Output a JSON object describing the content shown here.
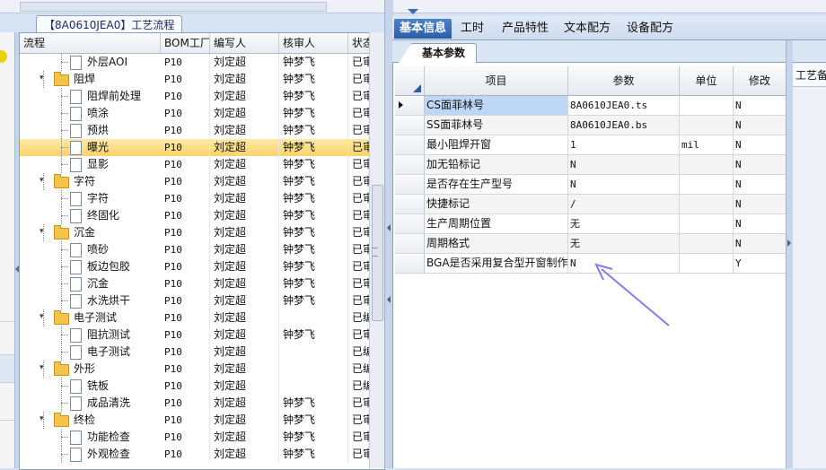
{
  "tree_window": {
    "title": "【8A0610JEA0】工艺流程",
    "columns": [
      "流程",
      "BOM工厂",
      "编写人",
      "核审人",
      "状态"
    ],
    "rows": [
      {
        "name": "外层AOI",
        "level": 2,
        "type": "doc",
        "factory": "P10",
        "writer": "刘定超",
        "reviewer": "钟梦飞",
        "status": "已审"
      },
      {
        "name": "阻焊",
        "level": 1,
        "type": "folder",
        "factory": "P10",
        "writer": "刘定超",
        "reviewer": "钟梦飞",
        "status": "已审"
      },
      {
        "name": "阻焊前处理",
        "level": 2,
        "type": "doc",
        "factory": "P10",
        "writer": "刘定超",
        "reviewer": "钟梦飞",
        "status": "已审"
      },
      {
        "name": "喷涂",
        "level": 2,
        "type": "doc",
        "factory": "P10",
        "writer": "刘定超",
        "reviewer": "钟梦飞",
        "status": "已审"
      },
      {
        "name": "预烘",
        "level": 2,
        "type": "doc",
        "factory": "P10",
        "writer": "刘定超",
        "reviewer": "钟梦飞",
        "status": "已审"
      },
      {
        "name": "曝光",
        "level": 2,
        "type": "doc",
        "factory": "P10",
        "writer": "刘定超",
        "reviewer": "钟梦飞",
        "status": "已审",
        "selected": true
      },
      {
        "name": "显影",
        "level": 2,
        "type": "doc",
        "factory": "P10",
        "writer": "刘定超",
        "reviewer": "钟梦飞",
        "status": "已审"
      },
      {
        "name": "字符",
        "level": 1,
        "type": "folder",
        "factory": "P10",
        "writer": "刘定超",
        "reviewer": "钟梦飞",
        "status": "已审"
      },
      {
        "name": "字符",
        "level": 2,
        "type": "doc",
        "factory": "P10",
        "writer": "刘定超",
        "reviewer": "钟梦飞",
        "status": "已审"
      },
      {
        "name": "终固化",
        "level": 2,
        "type": "doc",
        "factory": "P10",
        "writer": "刘定超",
        "reviewer": "钟梦飞",
        "status": "已审"
      },
      {
        "name": "沉金",
        "level": 1,
        "type": "folder",
        "factory": "P10",
        "writer": "刘定超",
        "reviewer": "钟梦飞",
        "status": "已审"
      },
      {
        "name": "喷砂",
        "level": 2,
        "type": "doc",
        "factory": "P10",
        "writer": "刘定超",
        "reviewer": "钟梦飞",
        "status": "已审"
      },
      {
        "name": "板边包胶",
        "level": 2,
        "type": "doc",
        "factory": "P10",
        "writer": "刘定超",
        "reviewer": "钟梦飞",
        "status": "已审"
      },
      {
        "name": "沉金",
        "level": 2,
        "type": "doc",
        "factory": "P10",
        "writer": "刘定超",
        "reviewer": "钟梦飞",
        "status": "已审"
      },
      {
        "name": "水洗烘干",
        "level": 2,
        "type": "doc",
        "factory": "P10",
        "writer": "刘定超",
        "reviewer": "钟梦飞",
        "status": "已审"
      },
      {
        "name": "电子测试",
        "level": 1,
        "type": "folder",
        "factory": "P10",
        "writer": "刘定超",
        "reviewer": "",
        "status": "已编"
      },
      {
        "name": "阻抗测试",
        "level": 2,
        "type": "doc",
        "factory": "P10",
        "writer": "刘定超",
        "reviewer": "钟梦飞",
        "status": "已审"
      },
      {
        "name": "电子测试",
        "level": 2,
        "type": "doc",
        "factory": "P10",
        "writer": "刘定超",
        "reviewer": "",
        "status": "已编"
      },
      {
        "name": "外形",
        "level": 1,
        "type": "folder",
        "factory": "P10",
        "writer": "刘定超",
        "reviewer": "",
        "status": "已编"
      },
      {
        "name": "铣板",
        "level": 2,
        "type": "doc",
        "factory": "P10",
        "writer": "刘定超",
        "reviewer": "",
        "status": "已编"
      },
      {
        "name": "成品清洗",
        "level": 2,
        "type": "doc",
        "factory": "P10",
        "writer": "刘定超",
        "reviewer": "钟梦飞",
        "status": "已审"
      },
      {
        "name": "终检",
        "level": 1,
        "type": "folder",
        "factory": "P10",
        "writer": "刘定超",
        "reviewer": "钟梦飞",
        "status": "已审"
      },
      {
        "name": "功能检查",
        "level": 2,
        "type": "doc",
        "factory": "P10",
        "writer": "刘定超",
        "reviewer": "钟梦飞",
        "status": "已审"
      },
      {
        "name": "外观检查",
        "level": 2,
        "type": "doc",
        "factory": "P10",
        "writer": "刘定超",
        "reviewer": "钟梦飞",
        "status": "已审"
      }
    ]
  },
  "main_tabs": [
    {
      "label": "基本信息",
      "active": true
    },
    {
      "label": "工时",
      "active": false
    },
    {
      "label": "产品特性",
      "active": false
    },
    {
      "label": "文本配方",
      "active": false
    },
    {
      "label": "设备配方",
      "active": false
    }
  ],
  "sub_tab": "基本参数",
  "param_grid": {
    "columns": [
      "项目",
      "参数",
      "单位",
      "修改"
    ],
    "rows": [
      {
        "item": "CS面菲林号",
        "param": "8A0610JEA0.ts",
        "unit": "",
        "modify": "N",
        "current": true
      },
      {
        "item": "SS面菲林号",
        "param": "8A0610JEA0.bs",
        "unit": "",
        "modify": "N"
      },
      {
        "item": "最小阻焊开窗",
        "param": "1",
        "unit": "mil",
        "modify": "N"
      },
      {
        "item": "加无铅标记",
        "param": "N",
        "unit": "",
        "modify": "N"
      },
      {
        "item": "是否存在生产型号",
        "param": "N",
        "unit": "",
        "modify": "N"
      },
      {
        "item": "快捷标记",
        "param": "/",
        "unit": "",
        "modify": "N"
      },
      {
        "item": "生产周期位置",
        "param": "无",
        "unit": "",
        "modify": "N"
      },
      {
        "item": "周期格式",
        "param": "无",
        "unit": "",
        "modify": "N"
      },
      {
        "item": "BGA是否采用复合型开窗制作",
        "param": "N",
        "unit": "",
        "modify": "Y"
      }
    ]
  },
  "right_panel": {
    "label": "工艺备"
  },
  "colors": {
    "selection": "#fbd36a",
    "active_tab": "#2b5ea8",
    "annotation_arrow": "#7f7fe6",
    "folder": "#f3c34a"
  }
}
